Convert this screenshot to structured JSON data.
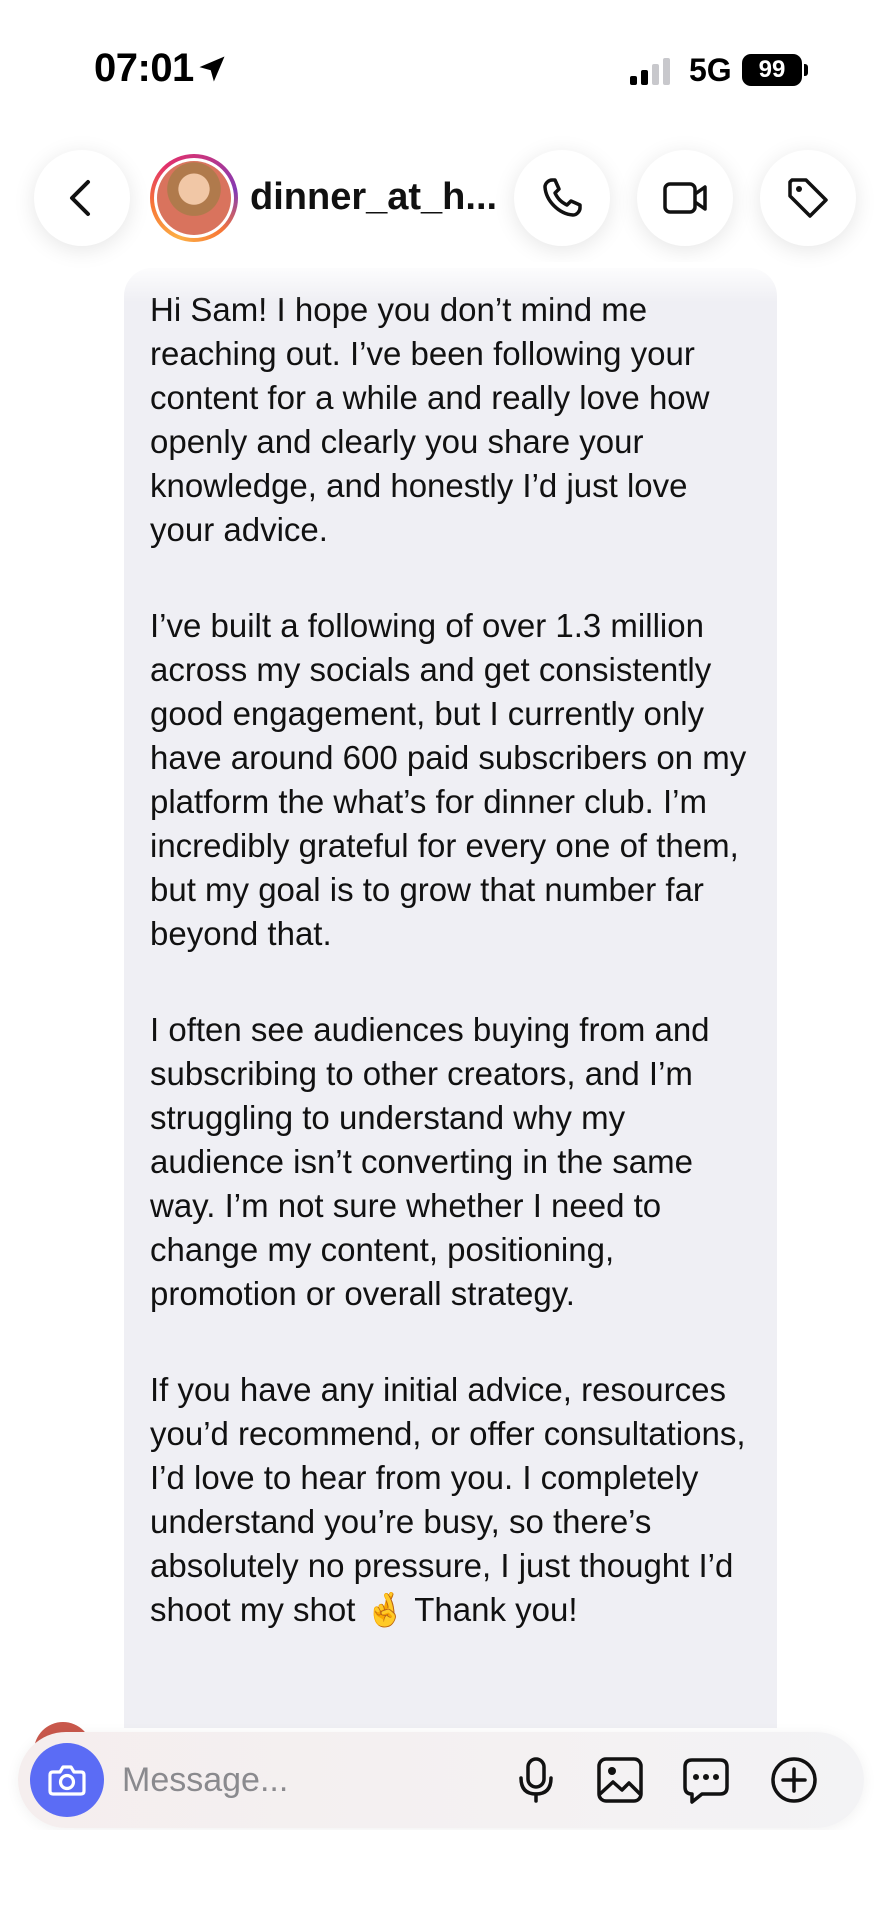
{
  "status_bar": {
    "time": "07:01",
    "network": "5G",
    "battery": "99"
  },
  "header": {
    "username": "dinner_at_h...",
    "icons": [
      "back-chevron-icon",
      "phone-icon",
      "video-camera-icon",
      "tag-icon"
    ]
  },
  "message": {
    "paragraphs": [
      "Hi Sam! I hope you don’t mind me reaching out. I’ve been following your content for a while and really love how openly and clearly you share your knowledge, and honestly I’d just love your advice.",
      "I’ve built a following of over 1.3 million across my socials and get consistently good engagement, but I currently only have around 600 paid subscribers on my platform the what’s for dinner club. I’m incredibly grateful for every one of them, but my goal is to grow that number far beyond that.",
      "I often see audiences buying from and subscribing to other creators, and I’m struggling to understand why my audience isn’t converting in the same way. I’m not sure whether I need to change my content, positioning, promotion or overall strategy.",
      "If you have any initial advice, resources you’d recommend, or offer consultations, I’d love to hear from you. I completely understand you’re busy, so there’s absolutely no pressure, I just thought I’d shoot my shot 🤞 Thank you!"
    ]
  },
  "composer": {
    "placeholder": "Message...",
    "icons": [
      "camera-icon",
      "microphone-icon",
      "gallery-icon",
      "sticker-chat-icon",
      "plus-icon"
    ],
    "accent_color": "#5b6cf5"
  }
}
